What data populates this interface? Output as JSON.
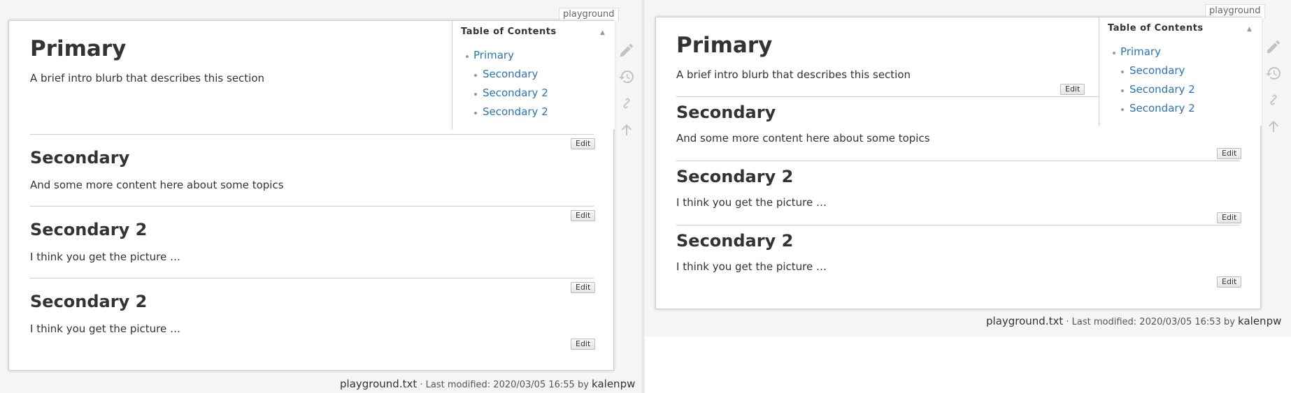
{
  "left": {
    "page_id": "playground",
    "title": "Primary",
    "intro": "A brief intro blurb that describes this section",
    "toc": {
      "heading": "Table of Contents",
      "toggle": "▲",
      "items": [
        "Primary",
        "Secondary",
        "Secondary 2",
        "Secondary 2"
      ]
    },
    "sections": [
      {
        "heading": "Secondary",
        "text": "And some more content here about some topics"
      },
      {
        "heading": "Secondary 2",
        "text": "I think you get the picture …"
      },
      {
        "heading": "Secondary 2",
        "text": "I think you get the picture …"
      }
    ],
    "edit_label": "Edit",
    "footer": {
      "file": "playground.txt",
      "sep": " · Last modified: ",
      "date": "2020/03/05 16:55",
      "by": " by ",
      "user": "kalenpw"
    }
  },
  "right": {
    "page_id": "playground",
    "title": "Primary",
    "intro": "A brief intro blurb that describes this section",
    "toc": {
      "heading": "Table of Contents",
      "toggle": "▲",
      "items": [
        "Primary",
        "Secondary",
        "Secondary 2",
        "Secondary 2"
      ]
    },
    "sections": [
      {
        "heading": "Secondary",
        "text": "And some more content here about some topics"
      },
      {
        "heading": "Secondary 2",
        "text": "I think you get the picture …"
      },
      {
        "heading": "Secondary 2",
        "text": "I think you get the picture …"
      }
    ],
    "edit_label": "Edit",
    "footer": {
      "file": "playground.txt",
      "sep": " · Last modified: ",
      "date": "2020/03/05 16:53",
      "by": " by ",
      "user": "kalenpw"
    }
  },
  "tools": {
    "icons": [
      "pencil-icon",
      "history-icon",
      "link-icon",
      "arrow-up-icon"
    ],
    "color": "#c3c3c3"
  },
  "colors": {
    "link": "#2b73b7",
    "text": "#333333",
    "background": "#f5f5f5"
  }
}
